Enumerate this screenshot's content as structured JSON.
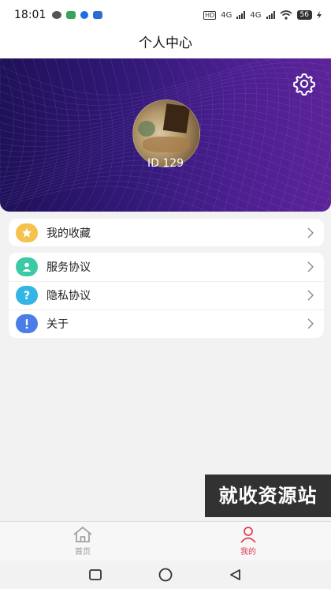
{
  "status_bar": {
    "time": "18:01",
    "hd_label": "HD",
    "net_label_1": "4G",
    "net_label_2": "4G",
    "battery": "56"
  },
  "header": {
    "title": "个人中心"
  },
  "profile": {
    "user_id": "ID 129"
  },
  "menu": {
    "favorites": {
      "label": "我的收藏",
      "icon": "star-icon",
      "color": "#f5c24d"
    },
    "items": [
      {
        "label": "服务协议",
        "icon": "user-icon",
        "color": "#3cc9a5"
      },
      {
        "label": "隐私协议",
        "icon": "question-icon",
        "color": "#33b5e5"
      },
      {
        "label": "关于",
        "icon": "info-icon",
        "color": "#4a7de8"
      }
    ]
  },
  "watermark": {
    "text": "就收资源站"
  },
  "tabbar": {
    "home": {
      "label": "首页",
      "icon": "home-icon"
    },
    "mine": {
      "label": "我的",
      "icon": "person-icon",
      "active_color": "#e03b4e"
    }
  },
  "colors": {
    "hero_start": "#1f1158",
    "hero_end": "#5d2399",
    "accent": "#e03b4e"
  }
}
